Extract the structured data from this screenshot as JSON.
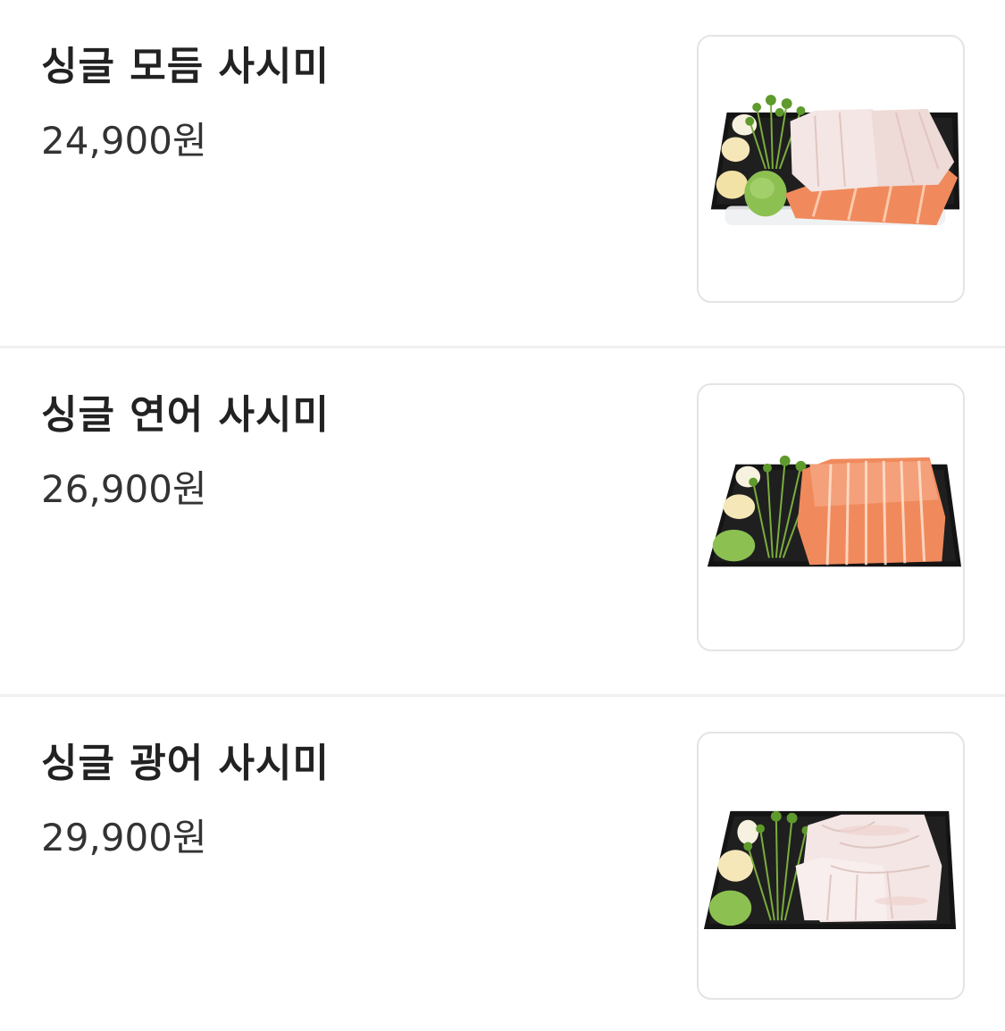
{
  "menu": {
    "items": [
      {
        "name": "싱글 모듬 사시미",
        "price": "24,900원",
        "image_icon": "mixed-sashimi-platter-image",
        "fish": "mixed"
      },
      {
        "name": "싱글 연어 사시미",
        "price": "26,900원",
        "image_icon": "salmon-sashimi-platter-image",
        "fish": "salmon"
      },
      {
        "name": "싱글 광어 사시미",
        "price": "29,900원",
        "image_icon": "flatfish-sashimi-platter-image",
        "fish": "flatfish"
      }
    ]
  },
  "colors": {
    "salmon": "#f08a5d",
    "white_fish": "#f3e6e4",
    "wasabi": "#8cc152",
    "ginger": "#f5e7b8",
    "tray": "#141414",
    "divider": "#f0f0f0",
    "thumb_border": "#e4e4e4"
  }
}
